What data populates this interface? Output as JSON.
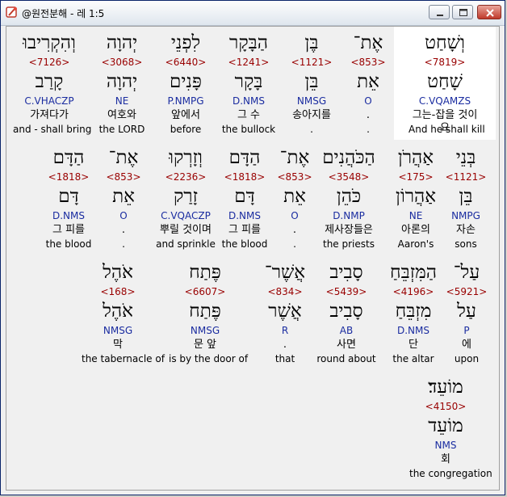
{
  "window": {
    "title": "@원전분해 - 레 1:5"
  },
  "rows": [
    {
      "words": [
        {
          "heb": "וְשָׁחַט",
          "strong": "<7819>",
          "lemma": "שָׁחַט",
          "morph": "C.VQAMZS",
          "kor": "그는-잡을 것이요",
          "eng": "And he shall kill"
        },
        {
          "heb": "אֶת־",
          "strong": "<853>",
          "lemma": "אֵת",
          "morph": "O",
          "kor": ".",
          "eng": "."
        },
        {
          "heb": "בֶּן",
          "strong": "<1121>",
          "lemma": "בֵּן",
          "morph": "NMSG",
          "kor": "송아지를",
          "eng": "."
        },
        {
          "heb": "הַבָּקָר",
          "strong": "<1241>",
          "lemma": "בָּקָר",
          "morph": "D.NMS",
          "kor": "그 수",
          "eng": "the bullock"
        },
        {
          "heb": "לִפְנֵי",
          "strong": "<6440>",
          "lemma": "פָּנִים",
          "morph": "P.NMPG",
          "kor": "앞에서",
          "eng": "before"
        },
        {
          "heb": "יְהוָה",
          "strong": "<3068>",
          "lemma": "יְהוָה",
          "morph": "NE",
          "kor": "여호와",
          "eng": "the LORD"
        },
        {
          "heb": "וְהִקְרִיבוּ",
          "strong": "<7126>",
          "lemma": "קָרַב",
          "morph": "C.VHACZP",
          "kor": "가져다가",
          "eng": "and - shall bring"
        }
      ]
    },
    {
      "words": [
        {
          "heb": "בְּנֵי",
          "strong": "<1121>",
          "lemma": "בֵּן",
          "morph": "NMPG",
          "kor": "자손",
          "eng": "sons"
        },
        {
          "heb": "אַהֲרֹן",
          "strong": "<175>",
          "lemma": "אַהֲרוֹן",
          "morph": "NE",
          "kor": "아론의",
          "eng": "Aaron's"
        },
        {
          "heb": "הַכֹּהֲנִים",
          "strong": "<3548>",
          "lemma": "כֹּהֵן",
          "morph": "D.NMP",
          "kor": "제사장들은",
          "eng": "the priests"
        },
        {
          "heb": "אֶת־",
          "strong": "<853>",
          "lemma": "אֵת",
          "morph": "O",
          "kor": ".",
          "eng": "."
        },
        {
          "heb": "הַדָּם",
          "strong": "<1818>",
          "lemma": "דָּם",
          "morph": "D.NMS",
          "kor": "그 피를",
          "eng": "the blood"
        },
        {
          "heb": "וְזָרְקוּ",
          "strong": "<2236>",
          "lemma": "זָרַק",
          "morph": "C.VQACZP",
          "kor": "뿌릴 것이며",
          "eng": "and sprinkle"
        },
        {
          "heb": "אֶת־",
          "strong": "<853>",
          "lemma": "אֵת",
          "morph": "O",
          "kor": ".",
          "eng": "."
        },
        {
          "heb": "הַדָּם",
          "strong": "<1818>",
          "lemma": "דָּם",
          "morph": "D.NMS",
          "kor": "그 피를",
          "eng": "the blood"
        }
      ]
    },
    {
      "words": [
        {
          "heb": "עַל־",
          "strong": "<5921>",
          "lemma": "עַל",
          "morph": "P",
          "kor": "에",
          "eng": "upon"
        },
        {
          "heb": "הַמִּזְבֵּחַ",
          "strong": "<4196>",
          "lemma": "מִזְבֵּחַ",
          "morph": "D.NMS",
          "kor": "단",
          "eng": "the altar"
        },
        {
          "heb": "סָבִיב",
          "strong": "<5439>",
          "lemma": "סָבִיב",
          "morph": "AB",
          "kor": "사면",
          "eng": "round about"
        },
        {
          "heb": "אֲשֶׁר־",
          "strong": "<834>",
          "lemma": "אֲשֶׁר",
          "morph": "R",
          "kor": ".",
          "eng": "that"
        },
        {
          "heb": "פֶּתַח",
          "strong": "<6607>",
          "lemma": "פֶּתַח",
          "morph": "NMSG",
          "kor": "문 앞",
          "eng": "is by the door of"
        },
        {
          "heb": "אֹהֶל",
          "strong": "<168>",
          "lemma": "אֹהֶל",
          "morph": "NMSG",
          "kor": "막",
          "eng": "the tabernacle of"
        }
      ]
    },
    {
      "words": [
        {
          "heb": "מוֹעֵד׃",
          "strong": "<4150>",
          "lemma": "מוֹעֵד",
          "morph": "NMS",
          "kor": "회",
          "eng": "the congregation"
        }
      ]
    }
  ]
}
